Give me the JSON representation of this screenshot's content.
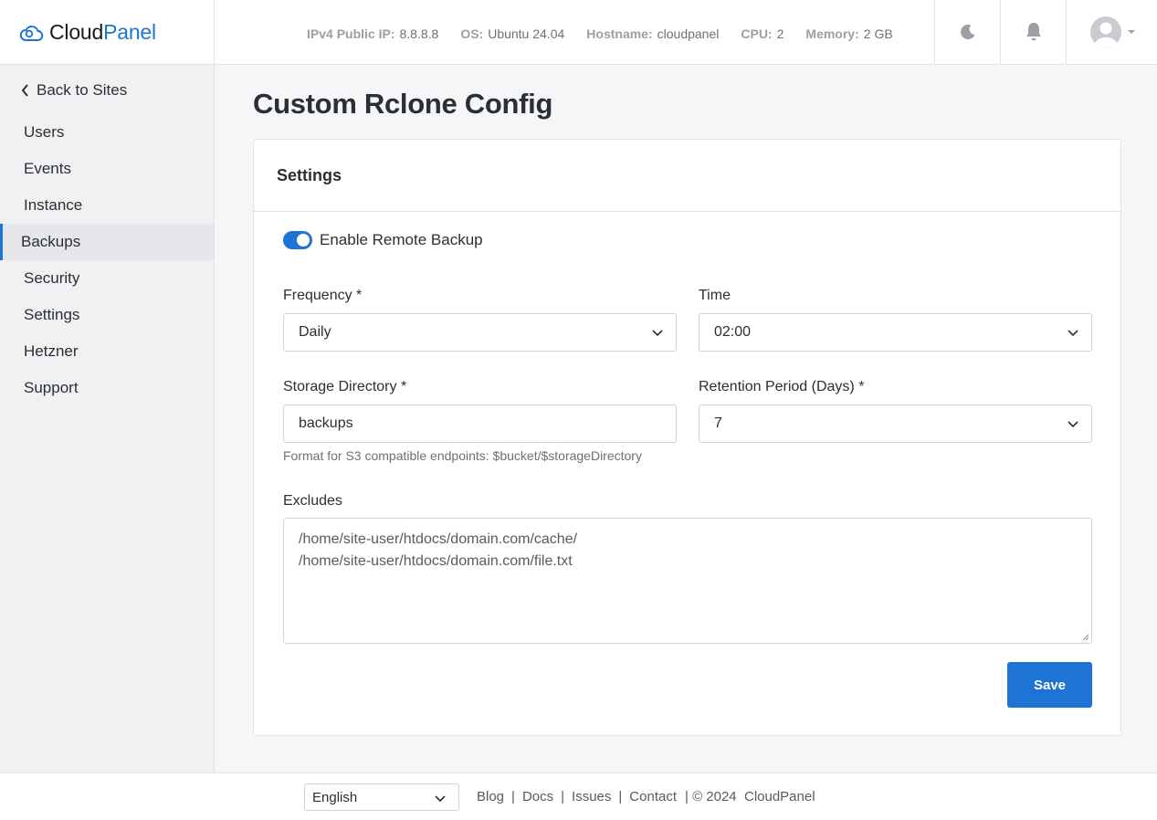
{
  "brand": {
    "name_part1": "Cloud",
    "name_part2": "Panel",
    "accent_color": "#1e74d4"
  },
  "header": {
    "sysinfo": [
      {
        "key": "IPv4 Public IP:",
        "value": "8.8.8.8"
      },
      {
        "key": "OS:",
        "value": "Ubuntu 24.04"
      },
      {
        "key": "Hostname:",
        "value": "cloudpanel"
      },
      {
        "key": "CPU:",
        "value": "2"
      },
      {
        "key": "Memory:",
        "value": "2 GB"
      }
    ],
    "icons": [
      "moon-icon",
      "bell-icon",
      "user-avatar-icon"
    ]
  },
  "sidebar": {
    "back_label": "Back to Sites",
    "items": [
      {
        "label": "Users",
        "active": false
      },
      {
        "label": "Events",
        "active": false
      },
      {
        "label": "Instance",
        "active": false
      },
      {
        "label": "Backups",
        "active": true
      },
      {
        "label": "Security",
        "active": false
      },
      {
        "label": "Settings",
        "active": false
      },
      {
        "label": "Hetzner",
        "active": false
      },
      {
        "label": "Support",
        "active": false
      }
    ]
  },
  "main": {
    "title": "Custom Rclone Config",
    "card_title": "Settings",
    "enable_remote_backup": {
      "label": "Enable Remote Backup",
      "checked": true
    },
    "frequency": {
      "label": "Frequency *",
      "value": "Daily"
    },
    "time": {
      "label": "Time",
      "value": "02:00"
    },
    "storage_directory": {
      "label": "Storage Directory *",
      "value": "backups",
      "help": "Format for S3 compatible endpoints: $bucket/$storageDirectory"
    },
    "retention": {
      "label": "Retention Period (Days) *",
      "value": "7"
    },
    "excludes": {
      "label": "Excludes",
      "lines": [
        "/home/site-user/htdocs/domain.com/cache/",
        "/home/site-user/htdocs/domain.com/file.txt"
      ]
    },
    "save_label": "Save"
  },
  "footer": {
    "language": "English",
    "links": [
      "Blog",
      "Docs",
      "Issues",
      "Contact"
    ],
    "copyright": "| © 2024  CloudPanel"
  }
}
